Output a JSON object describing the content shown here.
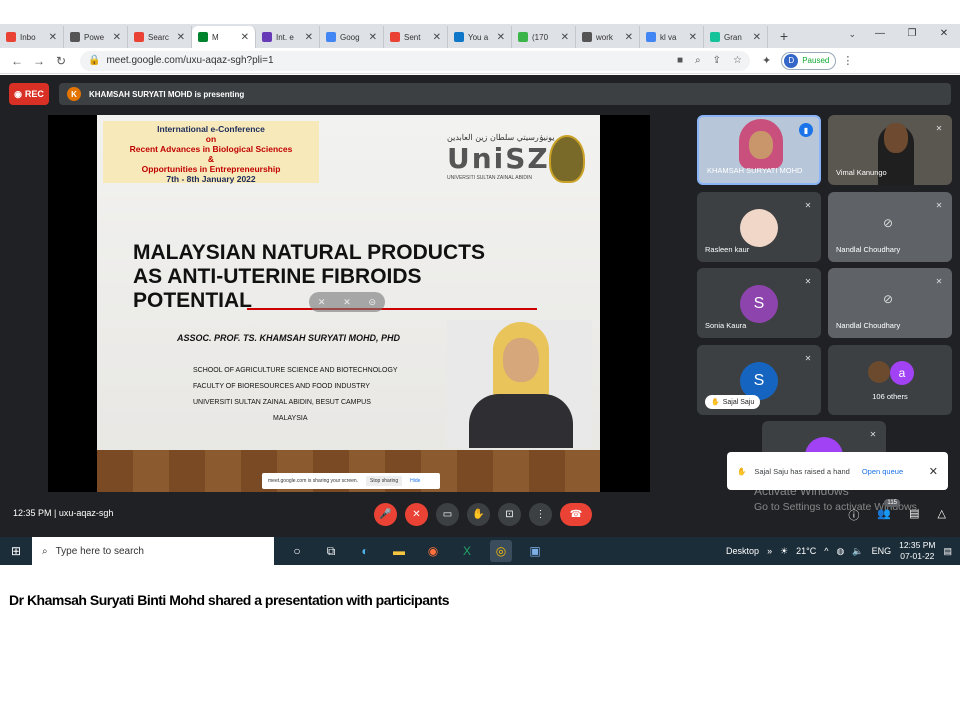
{
  "browser": {
    "tabs": [
      {
        "label": "Inbo",
        "color": "#ea4335",
        "icon": "gmail-icon"
      },
      {
        "label": "Powe",
        "color": "#555555",
        "icon": "globe-icon"
      },
      {
        "label": "Searc",
        "color": "#ea4335",
        "icon": "gmail-icon"
      },
      {
        "label": "M",
        "color": "#00832d",
        "icon": "meet-icon",
        "active": true
      },
      {
        "label": "Int. e",
        "color": "#673ab7",
        "icon": "forms-icon"
      },
      {
        "label": "Goog",
        "color": "#4285f4",
        "icon": "google-icon"
      },
      {
        "label": "Sent",
        "color": "#ea4335",
        "icon": "gmail-icon"
      },
      {
        "label": "You a",
        "color": "#0f77c9",
        "icon": "scopus-icon"
      },
      {
        "label": "(170",
        "color": "#3bb54a",
        "icon": "researchgate-icon"
      },
      {
        "label": "work",
        "color": "#555555",
        "icon": "globe-icon"
      },
      {
        "label": "kl va",
        "color": "#4285f4",
        "icon": "google-icon"
      },
      {
        "label": "Gran",
        "color": "#15c39a",
        "icon": "grammarly-icon"
      }
    ],
    "url": "meet.google.com/uxu-aqaz-sgh?pli=1",
    "profile_initial": "D",
    "profile_status": "Paused"
  },
  "meet": {
    "rec_label": "REC",
    "presenter_initial": "K",
    "presenting_text": "KHAMSAH SURYATI MOHD is presenting",
    "time": "12:35 PM",
    "separator": "|",
    "meeting_code": "uxu-aqaz-sgh",
    "participant_badge": "115",
    "hand_toast": {
      "text": "Sajal Saju has raised a hand",
      "action": "Open queue"
    },
    "watermark": {
      "title": "Activate Windows",
      "subtitle": "Go to Settings to activate Windows."
    },
    "participants": [
      {
        "name": "KHAMSAH SURYATI MOHD",
        "type": "video"
      },
      {
        "name": "Vimal Kanungo",
        "type": "video"
      },
      {
        "name": "Rasleen kaur",
        "type": "photo"
      },
      {
        "name": "Nandlal Choudhary",
        "type": "camoff"
      },
      {
        "name": "Sonia Kaura",
        "initial": "S",
        "color": "#8e44ad"
      },
      {
        "name": "Nandlal Choudhary",
        "type": "camoff"
      },
      {
        "name": "Sajal Saju",
        "initial": "S",
        "color": "#1565c0"
      },
      {
        "name": "106 others",
        "initial": "a",
        "color": "#a142f4"
      }
    ]
  },
  "slide": {
    "conf_line1": "International e-Conference",
    "conf_line2": "on",
    "conf_line3": "Recent Advances in Biological Sciences",
    "conf_line4": "&",
    "conf_line5": "Opportunities in Entrepreneurship",
    "conf_line6": "7th - 8th January 2022",
    "logo_arabic": "يونيۏرسيتي سلطان زين العابدين",
    "logo_text": "UniSZA",
    "logo_sub": "UNIVERSITI SULTAN ZAINAL ABIDIN",
    "title_line1": "MALAYSIAN NATURAL PRODUCTS",
    "title_line2": "AS ANTI-UTERINE FIBROIDS",
    "title_line3": "POTENTIAL",
    "author": "ASSOC. PROF. TS. KHAMSAH SURYATI MOHD, PHD",
    "affiliations": [
      "SCHOOL OF AGRICULTURE SCIENCE AND BIOTECHNOLOGY",
      "FACULTY OF BIORESOURCES AND FOOD INDUSTRY",
      "UNIVERSITI SULTAN ZAINAL ABIDIN, BESUT CAMPUS",
      "MALAYSIA"
    ],
    "share_text": "meet.google.com is sharing your screen.",
    "share_stop": "Stop sharing",
    "share_hide": "Hide"
  },
  "taskbar": {
    "search_placeholder": "Type here to search",
    "desktop_label": "Desktop",
    "temperature": "21°C",
    "language": "ENG",
    "time": "12:35 PM",
    "date": "07-01-22"
  },
  "caption": "Dr Khamsah Suryati Binti Mohd shared a presentation with participants"
}
